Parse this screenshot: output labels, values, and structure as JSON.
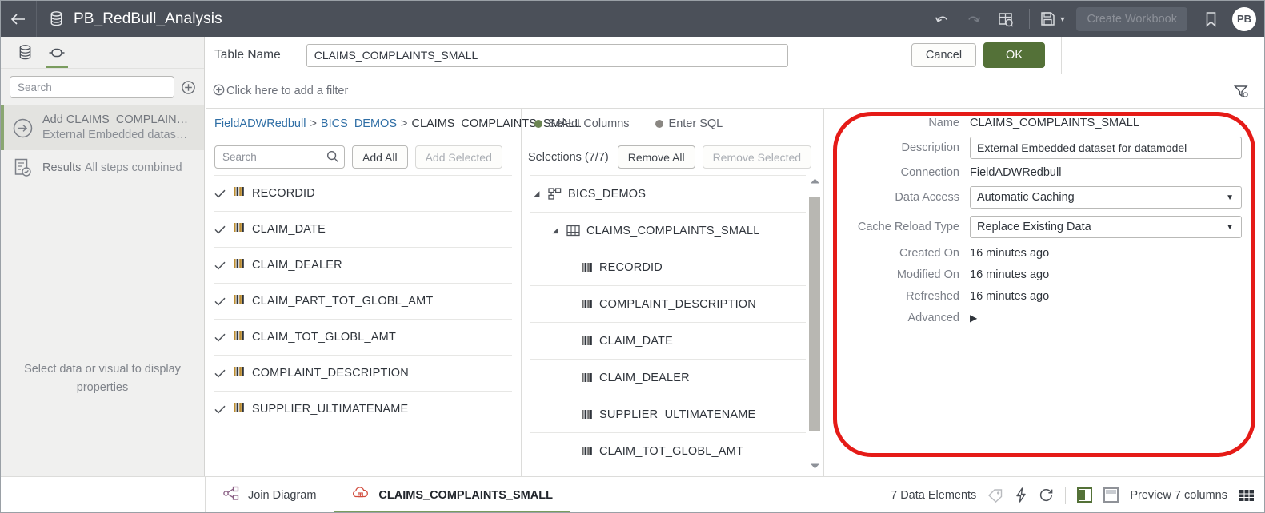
{
  "titlebar": {
    "back_icon": "arrow-left-icon",
    "dataset_icon": "database-icon",
    "title": "PB_RedBull_Analysis",
    "undo_icon": "undo-icon",
    "redo_icon": "redo-icon",
    "inspect_icon": "data-preview-icon",
    "save_icon": "save-icon",
    "save_caret": "▼",
    "create_workbook_label": "Create Workbook",
    "bookmark_icon": "bookmark-icon",
    "avatar_initials": "PB"
  },
  "sidebar": {
    "tabs": [
      {
        "name": "data-tab",
        "icon": "database-icon",
        "active": false
      },
      {
        "name": "prepare-tab",
        "icon": "dataflow-node-icon",
        "active": true
      }
    ],
    "search": {
      "placeholder": "Search",
      "value": ""
    },
    "add_icon": "plus-circle-icon",
    "steps": [
      {
        "icon": "arrow-right-circle-icon",
        "title": "Add CLAIMS_COMPLAIN…",
        "subtitle": "External Embedded datas…",
        "selected": true
      },
      {
        "icon": "results-icon",
        "title": "Results",
        "subtitle": "All steps combined",
        "selected": false
      }
    ],
    "empty_message": "Select data or visual to display properties"
  },
  "table_bar": {
    "label": "Table Name",
    "value": "CLAIMS_COMPLAINTS_SMALL",
    "placeholder": "Table Name",
    "cancel_label": "Cancel",
    "ok_label": "OK"
  },
  "filter_bar": {
    "add_icon": "plus-circle-icon",
    "add_filter_label": "Click here to add a filter",
    "filter_icon": "filter-off-icon"
  },
  "breadcrumb": {
    "connection": "FieldADWRedbull",
    "schema": "BICS_DEMOS",
    "table": "CLAIMS_COMPLAINTS_SMALL",
    "separator": ">"
  },
  "mode_toggle": {
    "options": [
      {
        "label": "Select Columns",
        "selected": true,
        "color": "#6b8452"
      },
      {
        "label": "Enter SQL",
        "selected": false,
        "color": "#8a8782"
      }
    ]
  },
  "columns_panel": {
    "search": {
      "placeholder": "Search",
      "value": ""
    },
    "search_icon": "search-icon",
    "add_all_label": "Add All",
    "add_selected_label": "Add Selected",
    "add_selected_disabled": true,
    "check_icon": "check-icon",
    "column_icon": "column-icon",
    "columns": [
      {
        "name": "RECORDID",
        "checked": true
      },
      {
        "name": "CLAIM_DATE",
        "checked": true
      },
      {
        "name": "CLAIM_DEALER",
        "checked": true
      },
      {
        "name": "CLAIM_PART_TOT_GLOBL_AMT",
        "checked": true
      },
      {
        "name": "CLAIM_TOT_GLOBL_AMT",
        "checked": true
      },
      {
        "name": "COMPLAINT_DESCRIPTION",
        "checked": true
      },
      {
        "name": "SUPPLIER_ULTIMATENAME",
        "checked": true
      }
    ]
  },
  "selections_panel": {
    "count_label": "Selections (7/7)",
    "remove_all_label": "Remove All",
    "remove_selected_label": "Remove Selected",
    "remove_selected_disabled": true,
    "scroll_up_icon": "chevron-up-icon",
    "scroll_down_icon": "chevron-down-icon",
    "tree": [
      {
        "level": 1,
        "label": "BICS_DEMOS",
        "icon": "schema-icon",
        "expanded": true,
        "arrow": "◢"
      },
      {
        "level": 2,
        "label": "CLAIMS_COMPLAINTS_SMALL",
        "icon": "table-icon",
        "expanded": true,
        "arrow": "◢"
      },
      {
        "level": 3,
        "label": "RECORDID",
        "icon": "column-icon",
        "expanded": null,
        "arrow": ""
      },
      {
        "level": 3,
        "label": "COMPLAINT_DESCRIPTION",
        "icon": "column-icon",
        "expanded": null,
        "arrow": ""
      },
      {
        "level": 3,
        "label": "CLAIM_DATE",
        "icon": "column-icon",
        "expanded": null,
        "arrow": ""
      },
      {
        "level": 3,
        "label": "CLAIM_DEALER",
        "icon": "column-icon",
        "expanded": null,
        "arrow": ""
      },
      {
        "level": 3,
        "label": "SUPPLIER_ULTIMATENAME",
        "icon": "column-icon",
        "expanded": null,
        "arrow": ""
      },
      {
        "level": 3,
        "label": "CLAIM_TOT_GLOBL_AMT",
        "icon": "column-icon",
        "expanded": null,
        "arrow": ""
      }
    ]
  },
  "properties_panel": {
    "name": {
      "label": "Name",
      "value": "CLAIMS_COMPLAINTS_SMALL"
    },
    "description": {
      "label": "Description",
      "value": "External Embedded dataset for datamodel"
    },
    "connection": {
      "label": "Connection",
      "value": "FieldADWRedbull"
    },
    "data_access": {
      "label": "Data Access",
      "value": "Automatic Caching",
      "caret": "▼"
    },
    "cache_reload_type": {
      "label": "Cache Reload Type",
      "value": "Replace Existing Data",
      "caret": "▼"
    },
    "created_on": {
      "label": "Created On",
      "value": "16 minutes ago"
    },
    "modified_on": {
      "label": "Modified On",
      "value": "16 minutes ago"
    },
    "refreshed": {
      "label": "Refreshed",
      "value": "16 minutes ago"
    },
    "advanced": {
      "label": "Advanced",
      "caret": "▶"
    }
  },
  "annotation": {
    "shape": "rounded-rectangle",
    "color": "#e51b17"
  },
  "bottom_bar": {
    "join_diagram": {
      "label": "Join Diagram",
      "icon": "join-diagram-icon",
      "active": false
    },
    "dataset_tab": {
      "label": "CLAIMS_COMPLAINTS_SMALL",
      "icon": "cloud-dataset-icon",
      "active": true
    },
    "data_elements_label": "7 Data Elements",
    "tag_icon": "tag-icon",
    "lightning_icon": "lightning-icon",
    "refresh_icon": "refresh-icon",
    "left_panel_toggle": "left-panel-toggle-icon",
    "bottom_panel_toggle": "bottom-panel-toggle-icon",
    "preview_label": "Preview 7 columns",
    "grid_icon": "grid-icon"
  }
}
